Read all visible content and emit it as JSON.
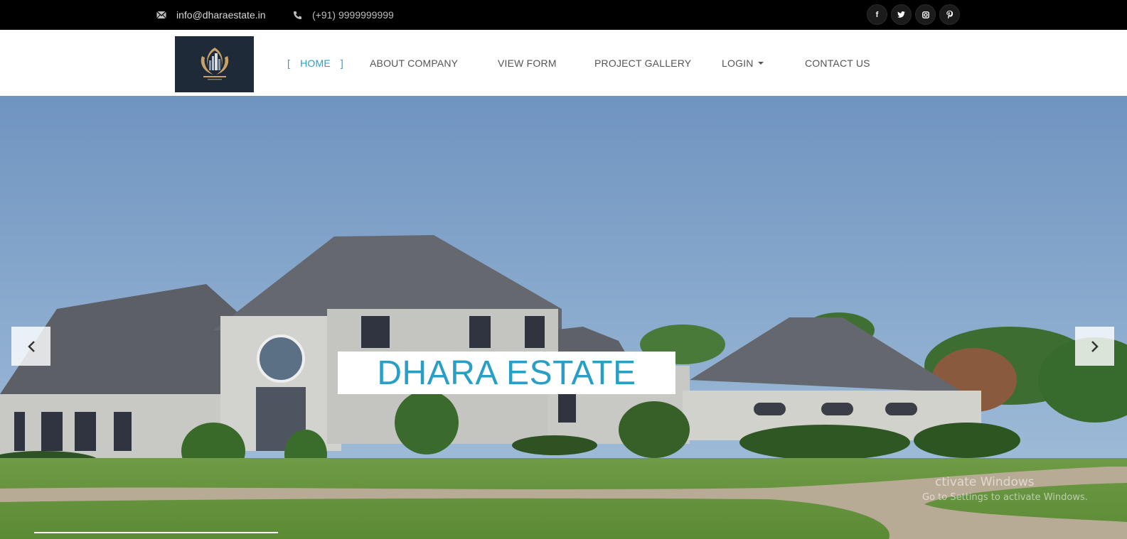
{
  "topbar": {
    "email": "info@dharaestate.in",
    "phone": "(+91) 9999999999",
    "social": [
      {
        "icon": "facebook-icon",
        "glyph": "f"
      },
      {
        "icon": "twitter-icon",
        "glyph": "t"
      },
      {
        "icon": "instagram-icon",
        "glyph": "◻"
      },
      {
        "icon": "pinterest-icon",
        "glyph": "p"
      }
    ]
  },
  "nav": {
    "items": [
      {
        "label": "HOME",
        "active": true
      },
      {
        "label": "ABOUT COMPANY"
      },
      {
        "label": "VIEW FORM"
      },
      {
        "label": "PROJECT GALLERY"
      },
      {
        "label": "LOGIN",
        "dropdown": true
      },
      {
        "label": "CONTACT US"
      }
    ],
    "home_bracket_open": "[",
    "home_bracket_close": "]"
  },
  "hero": {
    "caption": "DHARA ESTATE",
    "watermark_title": "ctivate Windows",
    "watermark_sub": "Go to Settings to activate Windows."
  },
  "colors": {
    "accent": "#2a9fc6",
    "topbar_bg": "#000000",
    "nav_text": "#555555"
  }
}
